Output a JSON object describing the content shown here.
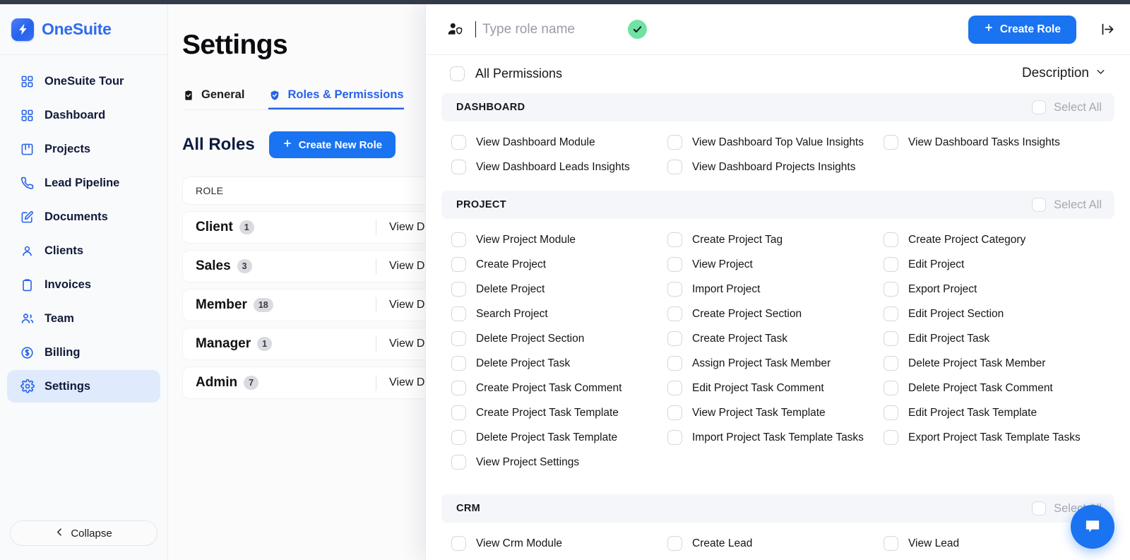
{
  "brand": {
    "name": "OneSuite",
    "logo_icon": "lightning-bolt-icon"
  },
  "sidebar": {
    "items": [
      {
        "label": "OneSuite Tour",
        "icon": "grid-icon",
        "active": false
      },
      {
        "label": "Dashboard",
        "icon": "grid-icon",
        "active": false
      },
      {
        "label": "Projects",
        "icon": "kanban-board-icon",
        "active": false
      },
      {
        "label": "Lead Pipeline",
        "icon": "phone-icon",
        "active": false
      },
      {
        "label": "Documents",
        "icon": "document-edit-icon",
        "active": false
      },
      {
        "label": "Clients",
        "icon": "user-icon",
        "active": false
      },
      {
        "label": "Invoices",
        "icon": "clipboard-icon",
        "active": false
      },
      {
        "label": "Team",
        "icon": "users-icon",
        "active": false
      },
      {
        "label": "Billing",
        "icon": "dollar-circle-icon",
        "active": false
      },
      {
        "label": "Settings",
        "icon": "gear-icon",
        "active": true
      }
    ],
    "collapse_label": "Collapse"
  },
  "page": {
    "title": "Settings",
    "tabs": [
      {
        "label": "General",
        "icon": "clipboard-check-icon",
        "active": false
      },
      {
        "label": "Roles & Permissions",
        "icon": "shield-icon",
        "active": true
      },
      {
        "label": "",
        "icon": "gear-icon",
        "active": false
      }
    ],
    "roles_section": {
      "title": "All Roles",
      "create_button": "Create New Role",
      "table": {
        "columns": [
          "ROLE"
        ],
        "rows": [
          {
            "name": "Client",
            "count": "1",
            "permissions": "View Das"
          },
          {
            "name": "Sales",
            "count": "3",
            "permissions": "View Das"
          },
          {
            "name": "Member",
            "count": "18",
            "permissions": "View Das"
          },
          {
            "name": "Manager",
            "count": "1",
            "permissions": "View Das"
          },
          {
            "name": "Admin",
            "count": "7",
            "permissions": "View Das"
          }
        ]
      }
    }
  },
  "drawer": {
    "role_name_value": "",
    "role_name_placeholder": "Type role name",
    "validation_icon": "check-circle-icon",
    "create_role_button": "Create Role",
    "close_icon": "exit-right-icon",
    "all_permissions_label": "All Permissions",
    "description_toggle": "Description",
    "select_all_label": "Select All",
    "groups": [
      {
        "name": "DASHBOARD",
        "permissions": [
          "View Dashboard Module",
          "View Dashboard Top Value Insights",
          "View Dashboard Tasks Insights",
          "View Dashboard Leads Insights",
          "View Dashboard Projects Insights"
        ]
      },
      {
        "name": "PROJECT",
        "permissions": [
          "View Project Module",
          "Create Project Tag",
          "Create Project Category",
          "Create Project",
          "View Project",
          "Edit Project",
          "Delete Project",
          "Import Project",
          "Export Project",
          "Search Project",
          "Create Project Section",
          "Edit Project Section",
          "Delete Project Section",
          "Create Project Task",
          "Edit Project Task",
          "Delete Project Task",
          "Assign Project Task Member",
          "Delete Project Task Member",
          "Create Project Task Comment",
          "Edit Project Task Comment",
          "Delete Project Task Comment",
          "Create Project Task Template",
          "View Project Task Template",
          "Edit Project Task Template",
          "Delete Project Task Template",
          "Import Project Task Template Tasks",
          "Export Project Task Template Tasks",
          "View Project Settings"
        ]
      },
      {
        "name": "CRM",
        "permissions": [
          "View Crm Module",
          "Create Lead",
          "View Lead"
        ]
      }
    ]
  },
  "chat_widget": {
    "icon": "chat-bubble-icon"
  },
  "colors": {
    "accent": "#1a73f0",
    "brand_text": "#2f6bf0",
    "success": "#6fe3a3",
    "top_strip": "#343b4a",
    "sidebar_bg": "#f9fafb",
    "active_nav_bg": "#dfeafd",
    "group_header_bg": "#f4f6fa"
  }
}
